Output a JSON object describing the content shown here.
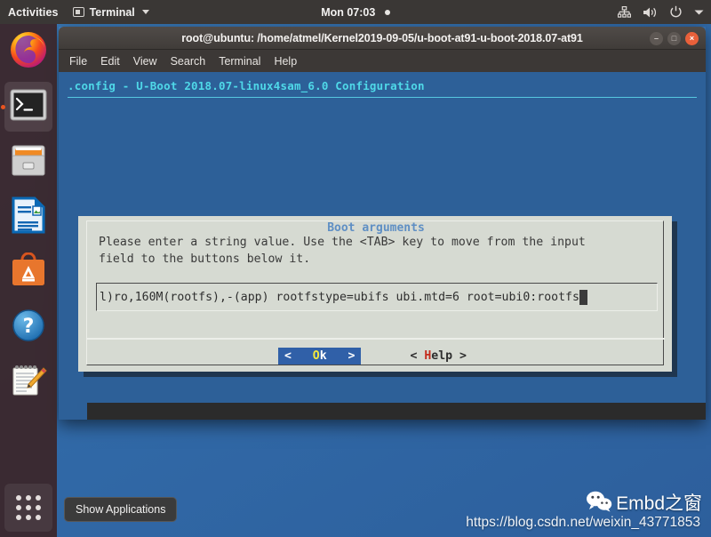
{
  "topbar": {
    "activities": "Activities",
    "app_name": "Terminal",
    "app_icon": "terminal-icon",
    "clock": "Mon 07:03",
    "sys_icons": [
      "network-icon",
      "volume-icon",
      "power-icon",
      "chevron-down-icon"
    ]
  },
  "dock": {
    "items": [
      {
        "name": "firefox",
        "label": "Firefox",
        "running": false
      },
      {
        "name": "terminal",
        "label": "Terminal",
        "running": true
      },
      {
        "name": "files",
        "label": "Files",
        "running": false
      },
      {
        "name": "libreoffice-writer",
        "label": "LibreOffice Writer",
        "running": false
      },
      {
        "name": "ubuntu-software",
        "label": "Ubuntu Software",
        "running": false
      },
      {
        "name": "help",
        "label": "Help",
        "running": false
      },
      {
        "name": "text-editor",
        "label": "Text Editor",
        "running": false
      }
    ],
    "show_applications": "Show Applications"
  },
  "window": {
    "title": "root@ubuntu: /home/atmel/Kernel2019-09-05/u-boot-at91-u-boot-2018.07-at91",
    "buttons": {
      "minimize": "–",
      "maximize": "□",
      "close": "×"
    },
    "menu": [
      "File",
      "Edit",
      "View",
      "Search",
      "Terminal",
      "Help"
    ]
  },
  "menuconfig": {
    "header": ".config - U-Boot 2018.07-linux4sam_6.0 Configuration",
    "header_color": "#4fd8e8",
    "bg_color": "#2d6098"
  },
  "dialog": {
    "title": "Boot arguments",
    "title_color": "#5f8fc4",
    "prompt_line1": "Please enter a string value. Use the <TAB> key to move from the input",
    "prompt_line2": "field to the buttons below it.",
    "input_value": "l)ro,160M(rootfs),-(app) rootfstype=ubifs ubi.mtd=6 root=ubi0:rootfs",
    "buttons": [
      {
        "name": "ok",
        "prefix": "<   ",
        "hotkey": "O",
        "rest": "k",
        "suffix": "   >",
        "selected": true,
        "bg_color": "#3060a8",
        "hotkey_color": "#f2e83c"
      },
      {
        "name": "help",
        "prefix": "< ",
        "hotkey": "H",
        "rest": "elp",
        "suffix": " >",
        "selected": false,
        "bg_color": "",
        "hotkey_color": "#c42b1c"
      }
    ]
  },
  "watermark": {
    "logo_text": "Embd之窗",
    "url": "https://blog.csdn.net/weixin_43771853"
  }
}
